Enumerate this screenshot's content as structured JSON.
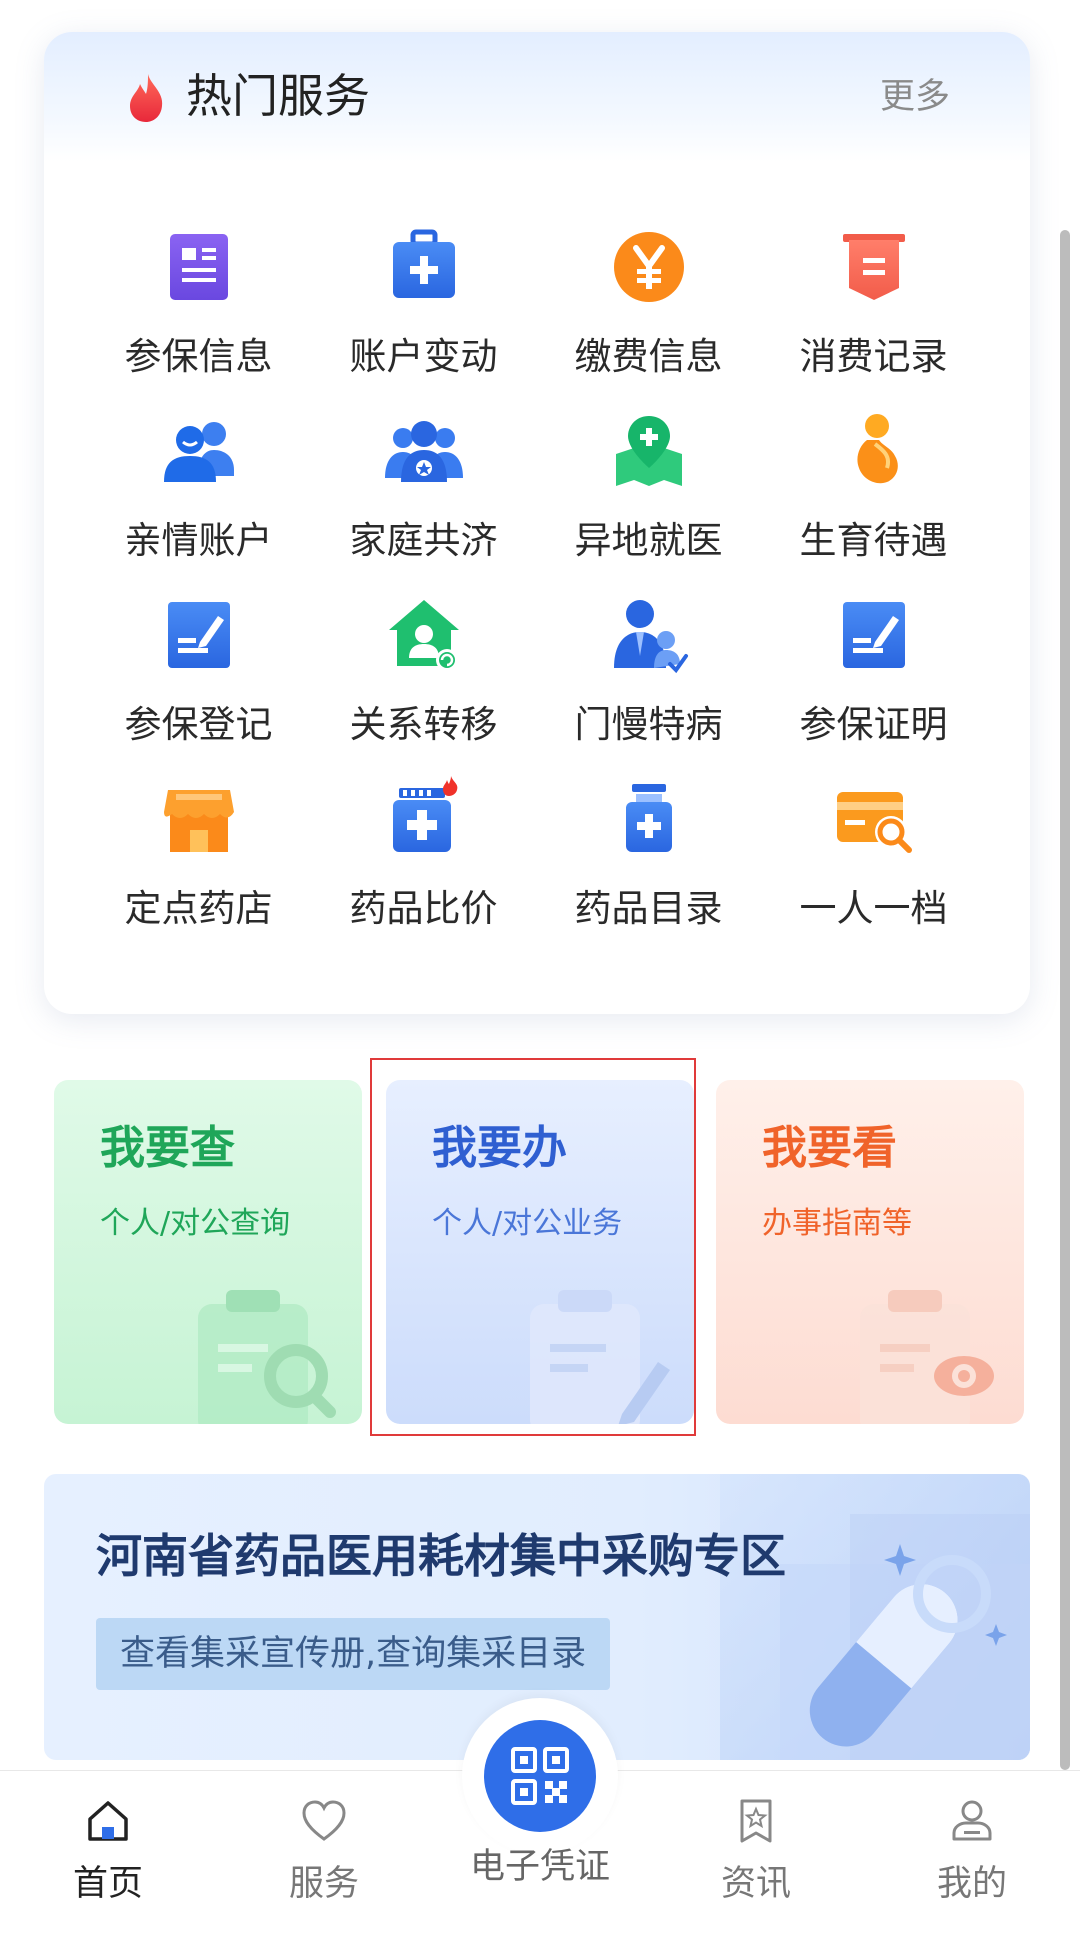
{
  "hot_services": {
    "title": "热门服务",
    "more": "更多",
    "items": [
      {
        "label": "参保信息",
        "icon": "document-list-icon"
      },
      {
        "label": "账户变动",
        "icon": "medical-bag-icon"
      },
      {
        "label": "缴费信息",
        "icon": "yen-coin-icon"
      },
      {
        "label": "消费记录",
        "icon": "receipt-icon"
      },
      {
        "label": "亲情账户",
        "icon": "family-users-icon"
      },
      {
        "label": "家庭共济",
        "icon": "group-star-icon"
      },
      {
        "label": "异地就医",
        "icon": "map-location-icon"
      },
      {
        "label": "生育待遇",
        "icon": "pregnancy-icon"
      },
      {
        "label": "参保登记",
        "icon": "edit-form-icon"
      },
      {
        "label": "关系转移",
        "icon": "house-transfer-icon"
      },
      {
        "label": "门慢特病",
        "icon": "doctor-check-icon"
      },
      {
        "label": "参保证明",
        "icon": "certificate-edit-icon"
      },
      {
        "label": "定点药店",
        "icon": "pharmacy-store-icon"
      },
      {
        "label": "药品比价",
        "icon": "medicine-compare-icon"
      },
      {
        "label": "药品目录",
        "icon": "medicine-bottle-icon"
      },
      {
        "label": "一人一档",
        "icon": "card-search-icon"
      }
    ]
  },
  "quick_actions": {
    "search": {
      "title": "我要查",
      "sub": "个人/对公查询"
    },
    "do": {
      "title": "我要办",
      "sub": "个人/对公业务"
    },
    "see": {
      "title": "我要看",
      "sub": "办事指南等"
    }
  },
  "banner": {
    "title": "河南省药品医用耗材集中采购专区",
    "sub": "查看集采宣传册,查询集采目录"
  },
  "bottom_nav": {
    "home": "首页",
    "service": "服务",
    "ecert": "电子凭证",
    "news": "资讯",
    "mine": "我的"
  },
  "colors": {
    "primary": "#2f6ee8",
    "green": "#1fa659",
    "orange": "#f0632a",
    "highlight": "#e03a3a"
  }
}
